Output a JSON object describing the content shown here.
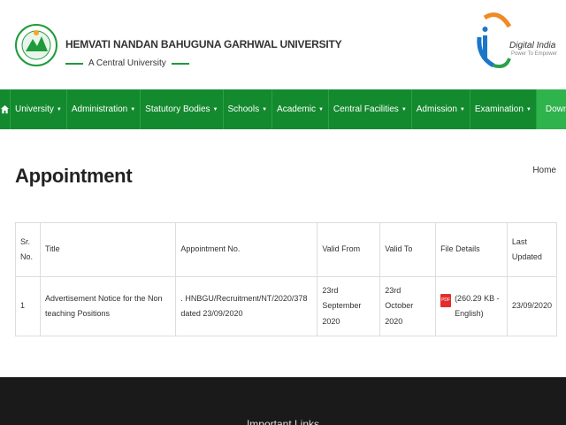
{
  "header": {
    "university_name": "HEMVATI NANDAN BAHUGUNA GARHWAL UNIVERSITY",
    "subtitle": "A Central University",
    "digital_india_title": "Digital India",
    "digital_india_tagline": "Power To Empower",
    "brand_color": "#148a2f"
  },
  "nav": {
    "home_icon": "home-icon",
    "items": [
      {
        "label": "University"
      },
      {
        "label": "Administration"
      },
      {
        "label": "Statutory Bodies"
      },
      {
        "label": "Schools"
      },
      {
        "label": "Academic"
      },
      {
        "label": "Central Facilities"
      },
      {
        "label": "Admission"
      },
      {
        "label": "Examination"
      }
    ],
    "download_label": "Download"
  },
  "page": {
    "title": "Appointment",
    "breadcrumb": "Home"
  },
  "table": {
    "headers": [
      "Sr. No.",
      "Title",
      "Appointment No.",
      "Valid From",
      "Valid To",
      "File Details",
      "Last Updated"
    ],
    "rows": [
      {
        "sr": "1",
        "title": "Advertisement Notice for the Non teaching Positions",
        "appointment_no": ". HNBGU/Recruitment/NT/2020/378 dated 23/09/2020",
        "valid_from": "23rd September 2020",
        "valid_to": "23rd October 2020",
        "file_details": "(260.29 KB - English)",
        "file_icon": "pdf-icon",
        "last_updated": "23/09/2020"
      }
    ]
  },
  "footer": {
    "title": "Important Links"
  }
}
